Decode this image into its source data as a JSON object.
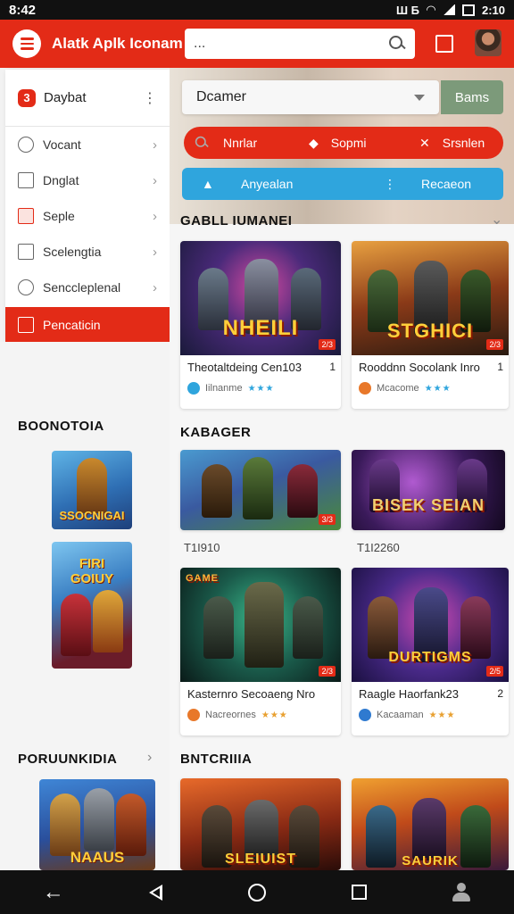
{
  "status_bar": {
    "time_left": "8:42",
    "time_right": "2:10",
    "indicator": "Ш Б"
  },
  "app_bar": {
    "title": "Alatk Aplk Iconam",
    "search_value": "...",
    "icons": [
      "menu-icon",
      "search-icon",
      "bookmark-icon",
      "avatar"
    ]
  },
  "sidebar": {
    "header": {
      "badge": "3",
      "label": "Daybat"
    },
    "items": [
      {
        "label": "Vocant",
        "icon": "clock-icon"
      },
      {
        "label": "Dnglat",
        "icon": "page-icon"
      },
      {
        "label": "Seple",
        "icon": "tile-icon"
      },
      {
        "label": "Scelengtia",
        "icon": "box-icon"
      },
      {
        "label": "Senccleplenal",
        "icon": "pin-icon"
      },
      {
        "label": "Pencaticin",
        "icon": "list-icon",
        "active": true
      }
    ]
  },
  "left_sections": [
    {
      "title": "BOONOTOIA",
      "thumbs": [
        "SSOCNIGAI",
        "FIRI GOIUY"
      ]
    },
    {
      "title": "PORUUNKIDIA",
      "thumbs": [
        "NAAUS"
      ]
    }
  ],
  "main": {
    "dropdown_value": "Dcamer",
    "filter_button": "Bams",
    "red_pill": [
      "Nnrlar",
      "Sopmi",
      "Srsnlen"
    ],
    "blue_pill": [
      "Anyealan",
      "Recaeon"
    ],
    "sections": [
      {
        "title": "GABLL IUMANEI",
        "cards": [
          {
            "image_text": "NHEILI",
            "title": "Theotaltdeing Cen103",
            "count": "1",
            "app": "Iilnanme",
            "stars": "★★★",
            "tag": "2/3"
          },
          {
            "image_text": "STGHICI",
            "title": "Rooddnn Socolank Inro",
            "count": "1",
            "app": "Mcacome",
            "stars": "★★★",
            "tag": "2/3"
          }
        ]
      },
      {
        "title": "KABAGER",
        "cards": [
          {
            "image_text": "",
            "date": "T1I910",
            "tag": "3/3"
          },
          {
            "image_text": "BISEK SEIAN",
            "date": "T1I2260"
          }
        ]
      },
      {
        "cards": [
          {
            "image_text": "GAME",
            "title": "Kasternro Secoaeng Nro",
            "app": "Nacreornes",
            "stars": "★★★",
            "tag": "2/3"
          },
          {
            "image_text": "DURTIGMS",
            "title": "Raagle Haorfank23",
            "count": "2",
            "app": "Kacaaman",
            "stars": "★★★",
            "tag": "2/5"
          }
        ]
      },
      {
        "title": "BNTCRIIIA",
        "cards": [
          {
            "image_text": "SLEIUIST"
          },
          {
            "image_text": "SAURIK"
          }
        ]
      }
    ]
  },
  "colors": {
    "accent": "#e32b17",
    "blue": "#2fa5dd",
    "gold": "#ffcf3a"
  }
}
